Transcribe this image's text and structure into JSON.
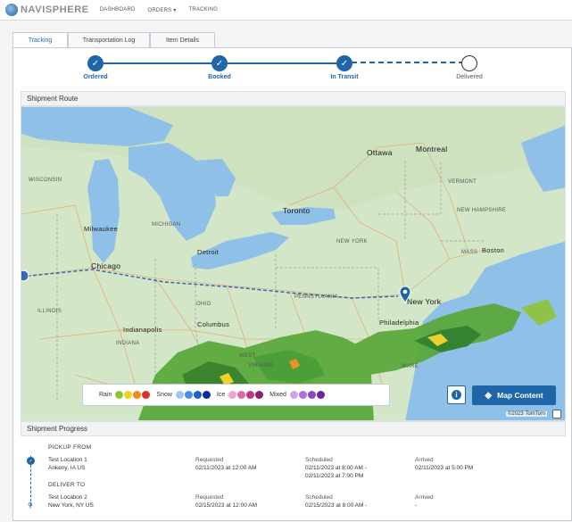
{
  "nav": {
    "logo_text": "NAVISPHERE",
    "items": [
      "DASHBOARD",
      "ORDERS ▾",
      "TRACKING"
    ]
  },
  "tabs": [
    "Tracking",
    "Transportation Log",
    "Item Details"
  ],
  "progress": {
    "steps": [
      {
        "label": "Ordered",
        "state": "done"
      },
      {
        "label": "Booked",
        "state": "done"
      },
      {
        "label": "In Transit",
        "state": "done"
      },
      {
        "label": "Delivered",
        "state": "pending"
      }
    ]
  },
  "shipment_route": {
    "title": "Shipment Route",
    "map_labels": {
      "ottawa": "Ottawa",
      "montreal": "Montreal",
      "wisconsin": "WISCONSIN",
      "vermont": "VERMONT",
      "new_hampshire": "NEW HAMPSHIRE",
      "milwaukee": "Milwaukee",
      "michigan": "MICHIGAN",
      "toronto": "Toronto",
      "new_york_state": "NEW YORK",
      "boston": "Boston",
      "detroit": "Detroit",
      "mass": "MASS",
      "chicago": "Chicago",
      "new_york_city": "New York",
      "pennsylvania": "PENNSYLVANIA",
      "illinois": "ILLINOIS",
      "ohio": "OHIO",
      "columbus": "Columbus",
      "philadelphia": "Philadelphia",
      "indianapolis": "Indianapolis",
      "indiana": "INDIANA",
      "west_virginia": "WEST",
      "virginia": "VIRGINIA",
      "delaware": "WARE"
    },
    "legend": {
      "rain": "Rain",
      "snow": "Snow",
      "ice": "Ice",
      "mixed": "Mixed",
      "rain_colors": [
        "#8fc43a",
        "#f2d21a",
        "#f08a1c",
        "#d9342b"
      ],
      "snow_colors": [
        "#9fc6f0",
        "#4a90e2",
        "#1d5fd1",
        "#0b2d9e"
      ],
      "ice_colors": [
        "#f0a6cc",
        "#e06aa8",
        "#c6348a",
        "#8e1f6a"
      ],
      "mixed_colors": [
        "#c9a6ec",
        "#a874dc",
        "#8a48c8",
        "#6a24a6"
      ]
    },
    "info_button": "i",
    "map_content_button": "Map Content",
    "copyright": "©2023 TomTom"
  },
  "shipment_progress": {
    "title": "Shipment Progress",
    "stops": [
      {
        "heading": "PICKUP FROM",
        "location_name": "Test Location 1",
        "location_city": "Ankeny, IA US",
        "requested_label": "Requested",
        "requested_value": "02/11/2023 at 12:00 AM",
        "scheduled_label": "Scheduled",
        "scheduled_value_1": "02/11/2023 at 8:00 AM -",
        "scheduled_value_2": "02/11/2023 at 7:00 PM",
        "arrived_label": "Arrived",
        "arrived_value": "02/11/2023 at 5:00 PM"
      },
      {
        "heading": "DELIVER TO",
        "location_name": "Test Location 2",
        "location_city": "New York, NY US",
        "requested_label": "Requested",
        "requested_value": "02/15/2023 at 12:00 AM",
        "scheduled_label": "Scheduled",
        "scheduled_value_1": "02/15/2023 at 8:00 AM -",
        "scheduled_value_2": "",
        "arrived_label": "Arrived",
        "arrived_value": "-"
      }
    ]
  }
}
